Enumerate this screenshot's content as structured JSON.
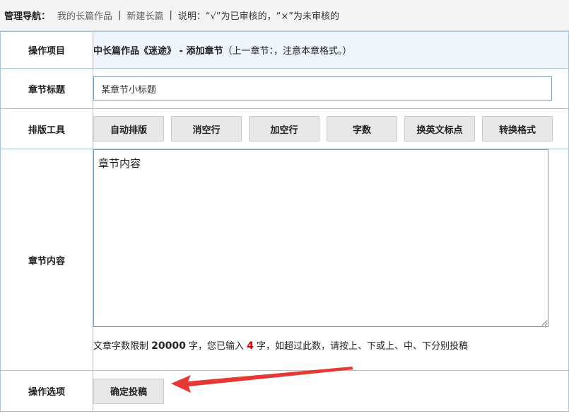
{
  "nav": {
    "label": "管理导航：",
    "link1": "我的长篇作品",
    "sep1": "|",
    "link2": "新建长篇",
    "sep2": "|",
    "note": "说明：“√”为已审核的，“×”为未审核的"
  },
  "rows": {
    "project_label": "操作项目",
    "project_bold": "中长篇作品《迷途》 - 添加章节",
    "project_rest": "（上一章节：，注意本章格式。）",
    "title_label": "章节标题",
    "title_placeholder": "某章节小标题",
    "tools_label": "排版工具",
    "content_label": "章节内容",
    "content_value": "章节内容",
    "options_label": "操作选项"
  },
  "tools": [
    "自动排版",
    "消空行",
    "加空行",
    "字数",
    "换英文标点",
    "转换格式"
  ],
  "count": {
    "prefix": "文章字数限制 ",
    "limit": "20000",
    "mid": " 字，您已输入 ",
    "typed": "4",
    "suffix": " 字，如超过此数，请按上、下或上、中、下分别投稿"
  },
  "submit_label": "确定投稿",
  "colors": {
    "arrow": "#e53935",
    "typed_count": "#cc0000",
    "border": "#a8c2d9"
  }
}
